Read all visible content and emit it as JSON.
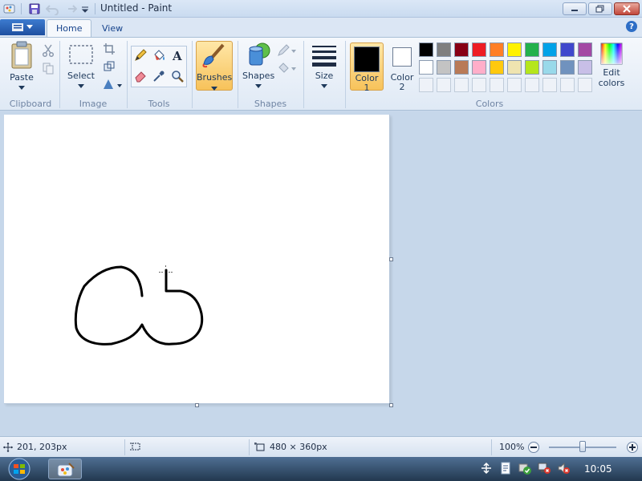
{
  "window": {
    "title": "Untitled - Paint"
  },
  "tabs": [
    {
      "label": "Home"
    },
    {
      "label": "View"
    }
  ],
  "ribbon": {
    "clipboard": {
      "paste_label": "Paste",
      "group_label": "Clipboard"
    },
    "image": {
      "select_label": "Select",
      "group_label": "Image"
    },
    "tools": {
      "group_label": "Tools"
    },
    "brushes": {
      "label": "Brushes"
    },
    "shapes": {
      "label": "Shapes",
      "group_label": "Shapes"
    },
    "size": {
      "label": "Size"
    },
    "colors": {
      "color1_label": "Color",
      "color1_num": "1",
      "color2_label": "Color",
      "color2_num": "2",
      "edit_label": "Edit",
      "edit_label2": "colors",
      "group_label": "Colors",
      "color1_value": "#000000",
      "color2_value": "#ffffff",
      "palette_row1": [
        "#000000",
        "#7f7f7f",
        "#880015",
        "#ed1c24",
        "#ff7f27",
        "#fff200",
        "#22b14c",
        "#00a2e8",
        "#3f48cc",
        "#a349a4"
      ],
      "palette_row2": [
        "#ffffff",
        "#c3c3c3",
        "#b97a57",
        "#ffaec9",
        "#ffc90e",
        "#efe4b0",
        "#b5e61d",
        "#99d9ea",
        "#7092be",
        "#c8bfe7"
      ]
    }
  },
  "statusbar": {
    "cursor_pos": "201, 203px",
    "canvas_size": "480 × 360px",
    "zoom": "100%"
  },
  "taskbar": {
    "time": "10:05"
  }
}
